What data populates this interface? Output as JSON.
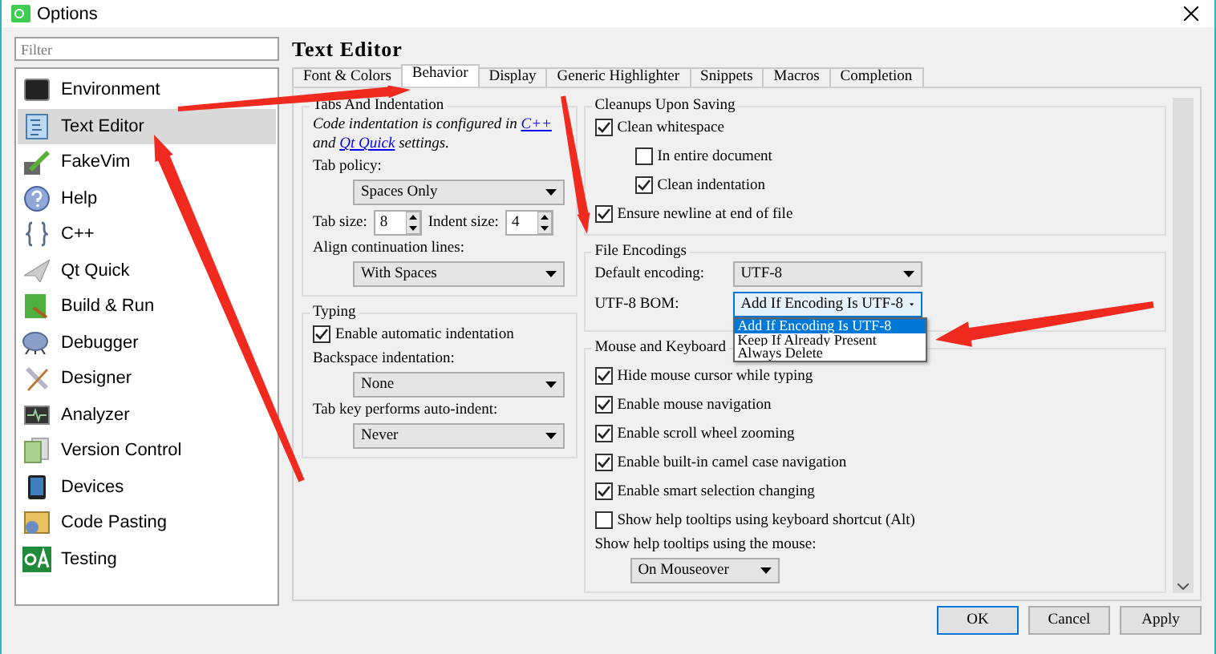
{
  "window": {
    "title": "Options"
  },
  "filter": {
    "placeholder": "Filter"
  },
  "categories": [
    {
      "label": "Environment",
      "selected": false
    },
    {
      "label": "Text Editor",
      "selected": true
    },
    {
      "label": "FakeVim",
      "selected": false
    },
    {
      "label": "Help",
      "selected": false
    },
    {
      "label": "C++",
      "selected": false
    },
    {
      "label": "Qt Quick",
      "selected": false
    },
    {
      "label": "Build & Run",
      "selected": false
    },
    {
      "label": "Debugger",
      "selected": false
    },
    {
      "label": "Designer",
      "selected": false
    },
    {
      "label": "Analyzer",
      "selected": false
    },
    {
      "label": "Version Control",
      "selected": false
    },
    {
      "label": "Devices",
      "selected": false
    },
    {
      "label": "Code Pasting",
      "selected": false
    },
    {
      "label": "Testing",
      "selected": false
    }
  ],
  "page_title": "Text Editor",
  "tabs": [
    {
      "label": "Font & Colors",
      "selected": false
    },
    {
      "label": "Behavior",
      "selected": true
    },
    {
      "label": "Display",
      "selected": false
    },
    {
      "label": "Generic Highlighter",
      "selected": false
    },
    {
      "label": "Snippets",
      "selected": false
    },
    {
      "label": "Macros",
      "selected": false
    },
    {
      "label": "Completion",
      "selected": false
    }
  ],
  "tabs_and_indentation": {
    "title": "Tabs And Indentation",
    "note": [
      {
        "kind": "text",
        "text": "Code indentation is configured in"
      },
      {
        "kind": "link",
        "text": "C++"
      },
      {
        "kind": "text",
        "text": "and"
      },
      {
        "kind": "link",
        "text": "Qt Quick"
      },
      {
        "kind": "text",
        "text": "settings."
      }
    ],
    "tab_policy": {
      "label": "Tab policy:",
      "value": "Spaces Only"
    },
    "tab_size": {
      "label": "Tab size:",
      "value": "8"
    },
    "indent_size": {
      "label": "Indent size:",
      "value": "4"
    },
    "align_continuation": {
      "label": "Align continuation lines:",
      "value": "With Spaces"
    }
  },
  "typing": {
    "title": "Typing",
    "auto_indent": {
      "label": "Enable automatic indentation",
      "checked": true
    },
    "backspace": {
      "label": "Backspace indentation:",
      "value": "None"
    },
    "tab_key": {
      "label": "Tab key performs auto-indent:",
      "value": "Never"
    }
  },
  "cleanups": {
    "title": "Cleanups Upon Saving",
    "options": [
      {
        "label": "Clean whitespace",
        "checked": true,
        "children": [
          {
            "label": "In entire document",
            "checked": false
          },
          {
            "label": "Clean indentation",
            "checked": true
          }
        ]
      },
      {
        "label": "Ensure newline at end of file",
        "checked": true
      }
    ]
  },
  "file_encodings": {
    "title": "File Encodings",
    "default_encoding": {
      "label": "Default encoding:",
      "value": "UTF-8"
    },
    "bom": {
      "label": "UTF-8 BOM:",
      "value": "Add If Encoding Is UTF-8",
      "options": [
        {
          "label": "Add If Encoding Is UTF-8",
          "selected": true
        },
        {
          "label": "Keep If Already Present",
          "selected": false
        },
        {
          "label": "Always Delete",
          "selected": false
        }
      ]
    }
  },
  "mouse_keyboard": {
    "title": "Mouse and Keyboard",
    "options": [
      {
        "label": "Hide mouse cursor while typing",
        "checked": true
      },
      {
        "label": "Enable mouse navigation",
        "checked": true
      },
      {
        "label": "Enable scroll wheel zooming",
        "checked": true
      },
      {
        "label": "Enable built-in camel case navigation",
        "checked": true
      },
      {
        "label": "Enable smart selection changing",
        "checked": true
      },
      {
        "label": "Show help tooltips using keyboard shortcut (Alt)",
        "checked": false
      }
    ],
    "help_tooltips": {
      "label": "Show help tooltips using the mouse:",
      "value": "On Mouseover"
    }
  },
  "buttons": [
    {
      "label": "OK",
      "default": true
    },
    {
      "label": "Cancel",
      "default": false
    },
    {
      "label": "Apply",
      "default": false
    }
  ]
}
